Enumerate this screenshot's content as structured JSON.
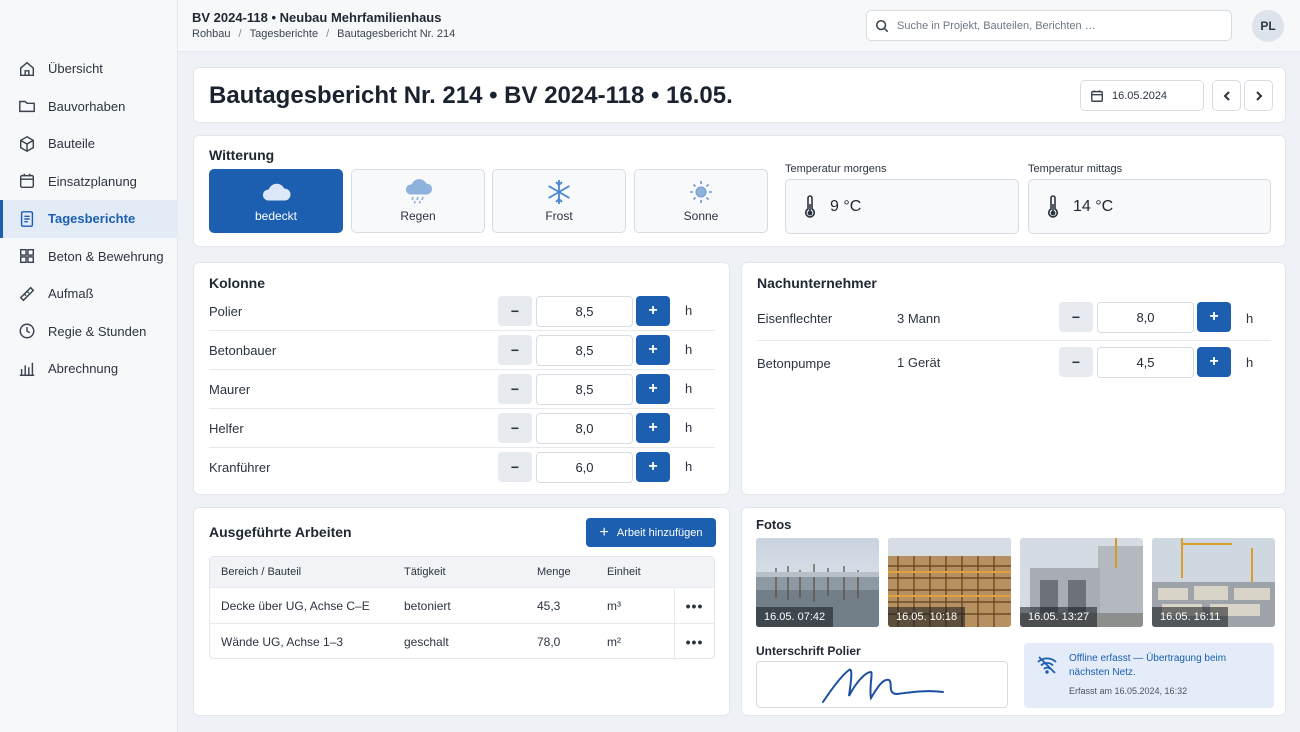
{
  "header": {
    "project_title": "BV 2024-118 • Neubau Mehrfamilienhaus",
    "breadcrumb": [
      "Rohbau",
      "Tagesberichte",
      "Bautagesbericht Nr. 214"
    ],
    "search_placeholder": "Suche in Projekt, Bauteilen, Berichten …",
    "avatar_initials": "PL"
  },
  "sidebar": {
    "items": [
      {
        "label": "Übersicht",
        "icon": "home-icon"
      },
      {
        "label": "Bauvorhaben",
        "icon": "folder-icon"
      },
      {
        "label": "Bauteile",
        "icon": "cube-icon"
      },
      {
        "label": "Einsatzplanung",
        "icon": "calendar-icon"
      },
      {
        "label": "Tagesberichte",
        "icon": "report-icon",
        "active": true
      },
      {
        "label": "Beton & Bewehrung",
        "icon": "grid-icon"
      },
      {
        "label": "Aufmaß",
        "icon": "ruler-icon"
      },
      {
        "label": "Regie & Stunden",
        "icon": "clock-icon"
      },
      {
        "label": "Abrechnung",
        "icon": "bar-chart-icon"
      }
    ]
  },
  "report": {
    "title": "Bautagesbericht Nr. 214 • BV 2024-118 • 16.05.",
    "date": "16.05.2024"
  },
  "weather": {
    "title": "Witterung",
    "options": [
      {
        "label": "bedeckt",
        "icon": "cloud-icon",
        "selected": true
      },
      {
        "label": "Regen",
        "icon": "rain-icon"
      },
      {
        "label": "Frost",
        "icon": "snowflake-icon"
      },
      {
        "label": "Sonne",
        "icon": "sun-icon"
      }
    ],
    "temp_morning_label": "Temperatur morgens",
    "temp_morning_value": "9 °C",
    "temp_noon_label": "Temperatur mittags",
    "temp_noon_value": "14 °C"
  },
  "crew": {
    "title": "Kolonne",
    "unit": "h",
    "minus": "−",
    "plus": "+",
    "rows": [
      {
        "role": "Polier",
        "hours": "8,5"
      },
      {
        "role": "Betonbauer",
        "hours": "8,5"
      },
      {
        "role": "Maurer",
        "hours": "8,5"
      },
      {
        "role": "Helfer",
        "hours": "8,0"
      },
      {
        "role": "Kranführer",
        "hours": "6,0"
      }
    ]
  },
  "subcontractors": {
    "title": "Nachunternehmer",
    "unit": "h",
    "rows": [
      {
        "name": "Eisenflechter",
        "count": "3 Mann",
        "hours": "8,0"
      },
      {
        "name": "Betonpumpe",
        "count": "1 Gerät",
        "hours": "4,5"
      }
    ]
  },
  "works": {
    "title": "Ausgeführte Arbeiten",
    "add_label": "Arbeit hinzufügen",
    "columns": [
      "Bereich / Bauteil",
      "Tätigkeit",
      "Menge",
      "Einheit"
    ],
    "rows": [
      {
        "area": "Decke über UG, Achse C–E",
        "activity": "betoniert",
        "qty": "45,3",
        "unit": "m³"
      },
      {
        "area": "Wände UG, Achse 1–3",
        "activity": "geschalt",
        "qty": "78,0",
        "unit": "m²"
      }
    ],
    "more": "•••"
  },
  "photos": {
    "title": "Fotos",
    "items": [
      {
        "timestamp": "16.05. 07:42"
      },
      {
        "timestamp": "16.05. 10:18"
      },
      {
        "timestamp": "16.05. 13:27"
      },
      {
        "timestamp": "16.05. 16:11"
      }
    ],
    "signature_label": "Unterschrift Polier"
  },
  "offline": {
    "message": "Offline erfasst — Übertragung beim nächsten Netz.",
    "captured": "Erfasst am 16.05.2024, 16:32"
  },
  "colors": {
    "accent": "#1c5fb0",
    "background": "#eef1f5",
    "card": "#ffffff"
  }
}
